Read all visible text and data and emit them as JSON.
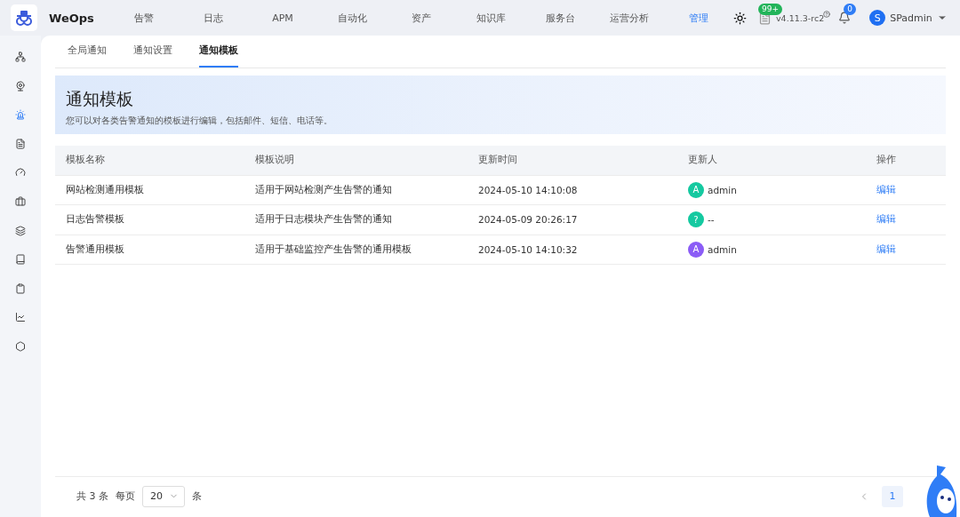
{
  "app": {
    "name": "WeOps"
  },
  "nav": [
    {
      "label": "告警",
      "selected": false
    },
    {
      "label": "日志",
      "selected": false
    },
    {
      "label": "APM",
      "selected": false
    },
    {
      "label": "自动化",
      "selected": false
    },
    {
      "label": "资产",
      "selected": false
    },
    {
      "label": "知识库",
      "selected": false
    },
    {
      "label": "服务台",
      "selected": false
    },
    {
      "label": "运营分析",
      "selected": false
    },
    {
      "label": "管理",
      "selected": true
    }
  ],
  "header": {
    "notice_badge": "99+",
    "version": "v4.11.3-rc2",
    "bell_badge": "0",
    "user_initial": "S",
    "user": "SPadmin"
  },
  "sidebar": {
    "items": [
      {
        "kind": "network",
        "selected": false
      },
      {
        "kind": "webcam",
        "selected": false
      },
      {
        "kind": "siren",
        "selected": true
      },
      {
        "kind": "report",
        "selected": false
      },
      {
        "kind": "gauge",
        "selected": false
      },
      {
        "kind": "briefcase",
        "selected": false
      },
      {
        "kind": "layers",
        "selected": false
      },
      {
        "kind": "book",
        "selected": false
      },
      {
        "kind": "clipboard",
        "selected": false
      },
      {
        "kind": "chart",
        "selected": false
      },
      {
        "kind": "hexagon",
        "selected": false
      }
    ]
  },
  "tabs": [
    {
      "label": "全局通知",
      "selected": false
    },
    {
      "label": "通知设置",
      "selected": false
    },
    {
      "label": "通知模板",
      "selected": true
    }
  ],
  "banner": {
    "title": "通知模板",
    "subtitle": "您可以对各类告警通知的模板进行编辑，包括邮件、短信、电话等。"
  },
  "table": {
    "columns": [
      "模板名称",
      "模板说明",
      "更新时间",
      "更新人",
      "操作"
    ],
    "rows": [
      {
        "name": "网站检测通用模板",
        "description": "适用于网站检测产生告警的通知",
        "updated": "2024-05-10 14:10:08",
        "avatar": "A",
        "color": "#14c9a0",
        "user": "admin",
        "action": "编辑"
      },
      {
        "name": "日志告警模板",
        "description": "适用于日志模块产生告警的通知",
        "updated": "2024-05-09 20:26:17",
        "avatar": "?",
        "color": "#14c9a0",
        "user": "--",
        "action": "编辑"
      },
      {
        "name": "告警通用模板",
        "description": "适用于基础监控产生告警的通用模板",
        "updated": "2024-05-10 14:10:32",
        "avatar": "A",
        "color": "#8b5cf6",
        "user": "admin",
        "action": "编辑"
      }
    ]
  },
  "pagination": {
    "total": "共 3 条",
    "per_page_label": "每页",
    "page_size": "20",
    "unit": "条",
    "pages": [
      {
        "label": "1",
        "selected": true
      }
    ]
  }
}
